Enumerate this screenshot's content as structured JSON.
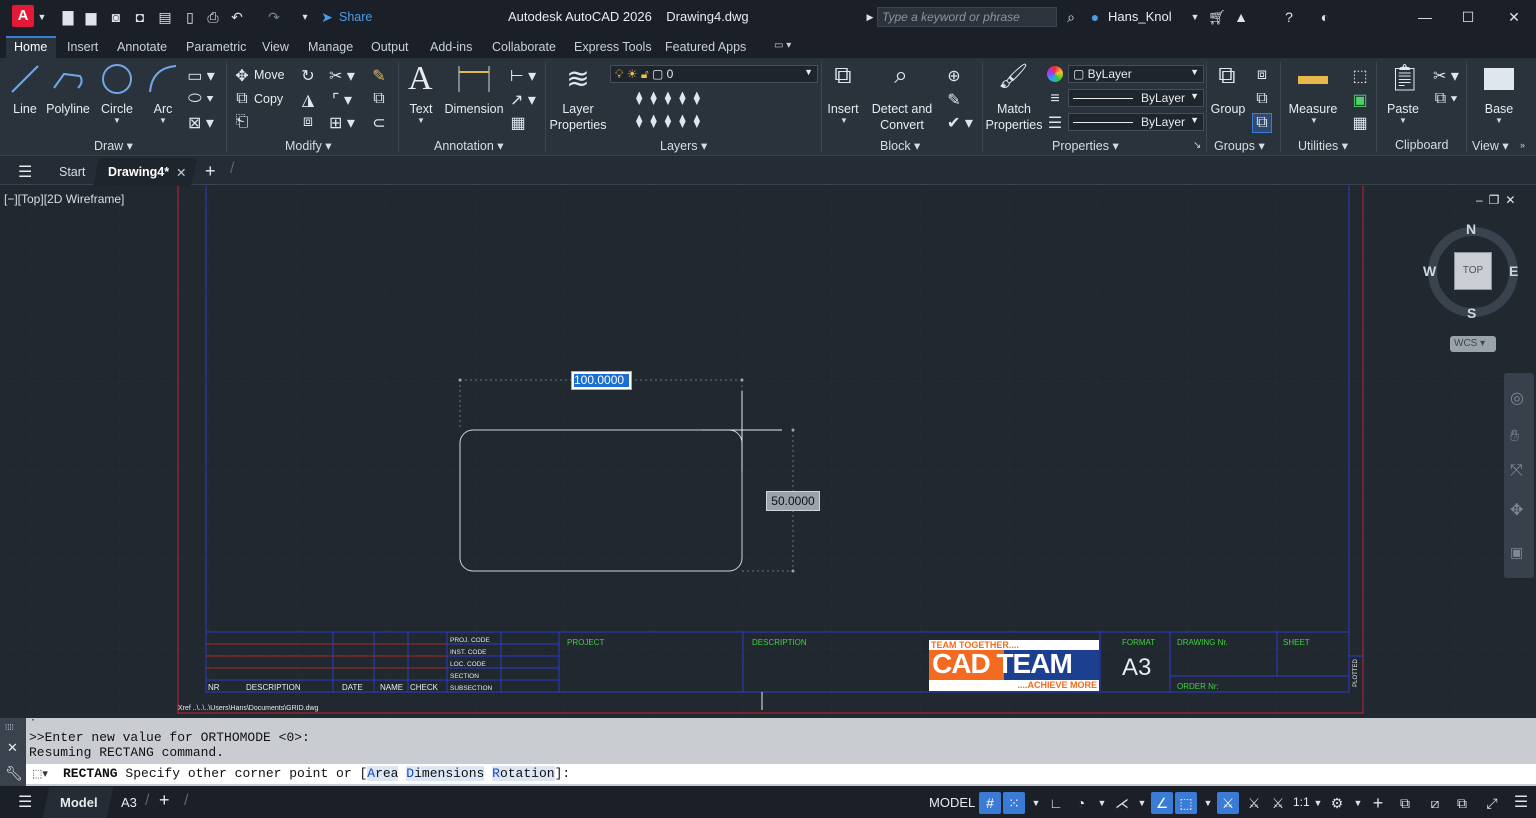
{
  "app": {
    "logo_letter": "A",
    "title": "Autodesk AutoCAD 2026",
    "document": "Drawing4.dwg",
    "share": "Share",
    "search_placeholder": "Type a keyword or phrase",
    "user": "Hans_Knol"
  },
  "ribbon_tabs": [
    "Home",
    "Insert",
    "Annotate",
    "Parametric",
    "View",
    "Manage",
    "Output",
    "Add-ins",
    "Collaborate",
    "Express Tools",
    "Featured Apps"
  ],
  "ribbon": {
    "draw": {
      "line": "Line",
      "polyline": "Polyline",
      "circle": "Circle",
      "arc": "Arc",
      "title": "Draw"
    },
    "modify": {
      "move": "Move",
      "copy": "Copy",
      "title": "Modify"
    },
    "annotation": {
      "text": "Text",
      "dimension": "Dimension",
      "title": "Annotation"
    },
    "layers": {
      "properties_l1": "Layer",
      "properties_l2": "Properties",
      "current_layer": "0",
      "title": "Layers"
    },
    "block": {
      "insert": "Insert",
      "detect_l1": "Detect and",
      "detect_l2": "Convert",
      "title": "Block"
    },
    "properties": {
      "match_l1": "Match",
      "match_l2": "Properties",
      "color": "ByLayer",
      "linetype": "ByLayer",
      "lineweight": "ByLayer",
      "title": "Properties"
    },
    "groups": {
      "group": "Group",
      "title": "Groups"
    },
    "utilities": {
      "measure": "Measure",
      "title": "Utilities"
    },
    "clipboard": {
      "paste": "Paste",
      "title": "Clipboard"
    },
    "view": {
      "base": "Base",
      "title": "View"
    }
  },
  "doc_tabs": {
    "start": "Start",
    "active": "Drawing4*"
  },
  "viewport": {
    "label": "[−][Top][2D Wireframe]",
    "dim_width": "100.0000",
    "dim_height": "50.0000",
    "xref": "Xref ..\\..\\..\\Users\\Hans\\Documents\\GRID.dwg",
    "viewcube": {
      "n": "N",
      "s": "S",
      "e": "E",
      "w": "W",
      "top": "TOP",
      "wcs": "WCS"
    },
    "titleblock": {
      "proj_code": "PROJ. CODE",
      "inst_code": "INST. CODE",
      "loc_code": "LOC. CODE",
      "section": "SECTION",
      "subsection": "SUBSECTION",
      "nr": "NR",
      "description_col": "DESCRIPTION",
      "date": "DATE",
      "name": "NAME",
      "check": "CHECK",
      "project": "PROJECT",
      "description": "DESCRIPTION",
      "format": "FORMAT",
      "format_value": "A3",
      "drawing_nr": "DRAWING Nr.",
      "sheet": "SHEET",
      "order_nr": "ORDER Nr:",
      "plotted": "PLOTTED",
      "logo_top": "TEAM TOGETHER....",
      "logo_main": "CAD TEAM",
      "logo_bottom": "....ACHIEVE MORE"
    }
  },
  "command": {
    "history": [
      ">>Enter new value for ORTHOMODE <0>:",
      "Resuming RECTANG command."
    ],
    "prompt_cmd": "RECTANG",
    "prompt_text": "Specify other corner point or [",
    "opt1": "Area",
    "opt2": "Dimensions",
    "opt3": "Rotation",
    "prompt_end": "]:"
  },
  "status": {
    "model_tab": "Model",
    "layout_tab": "A3",
    "model_btn": "MODEL",
    "scale": "1:1"
  },
  "colors": {
    "accent": "#3a7bd5",
    "brand_red": "#e31937",
    "logo_orange": "#f26b21",
    "logo_blue": "#1d3f8f"
  }
}
